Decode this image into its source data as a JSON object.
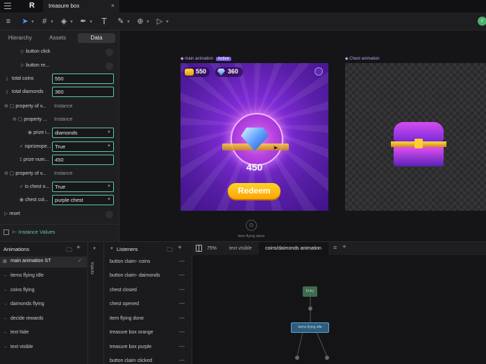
{
  "app": {
    "logo_letter": "R",
    "tab_title": "treasure box",
    "avatar_letter": "r"
  },
  "panel": {
    "tabs": [
      "Hierarchy",
      "Assets",
      "Data"
    ],
    "rows": {
      "button_click": "button click",
      "button_re": "button re...",
      "total_coins_label": "total coins",
      "total_coins_value": "550",
      "total_diamonds_label": "total diamonds",
      "total_diamonds_value": "360",
      "prop1_label": "property of v...",
      "prop1_value": "Instance",
      "prop2_label": "property ...",
      "prop2_value": "Instance",
      "prize_label": "prize i...",
      "prize_value": "diamonds",
      "isprize_label": "isprizeope...",
      "isprize_value": "True",
      "prizenum_label": "prize num...",
      "prizenum_value": "450",
      "prop3_label": "property of v...",
      "prop3_value": "Instance",
      "ischest_label": "is chest o...",
      "ischest_value": "True",
      "chestcol_label": "chest col...",
      "chestcol_value": "purple chest",
      "reset": "reset",
      "gutter_one": "1"
    },
    "instance_values": "Instance Values"
  },
  "canvas": {
    "artboard1_title": "main animation",
    "artboard1_badge": "Active",
    "coins": "550",
    "diamonds": "360",
    "prize_amount": "450",
    "redeem": "Redeem",
    "artboard2_title": "Chest animation",
    "flying_label": "item flying done"
  },
  "animations": {
    "title": "Animations",
    "items": [
      "main animation ST",
      "items flying idle",
      "coins flying",
      "daimonds flying",
      "decide rewards",
      "text hide",
      "text visible"
    ]
  },
  "inputs_label": "Inputs",
  "listeners": {
    "title": "Listeners",
    "items": [
      "button claim- coins",
      "button claim- daimonds",
      "chest closed",
      "chest opened",
      "item flying done",
      "treasure box orange",
      "treasure box purple",
      "button claim clicked"
    ]
  },
  "graph": {
    "zoom": "75%",
    "tabs": [
      "text visible",
      "coins/daimonds animation"
    ],
    "entry": "Entry",
    "state": "items flying idle"
  },
  "colors": {
    "accent": "#5ec7a8",
    "active_badge": "#7d56e8",
    "redeem": "#ffb400",
    "bg_purple": "#5a1fa8"
  }
}
